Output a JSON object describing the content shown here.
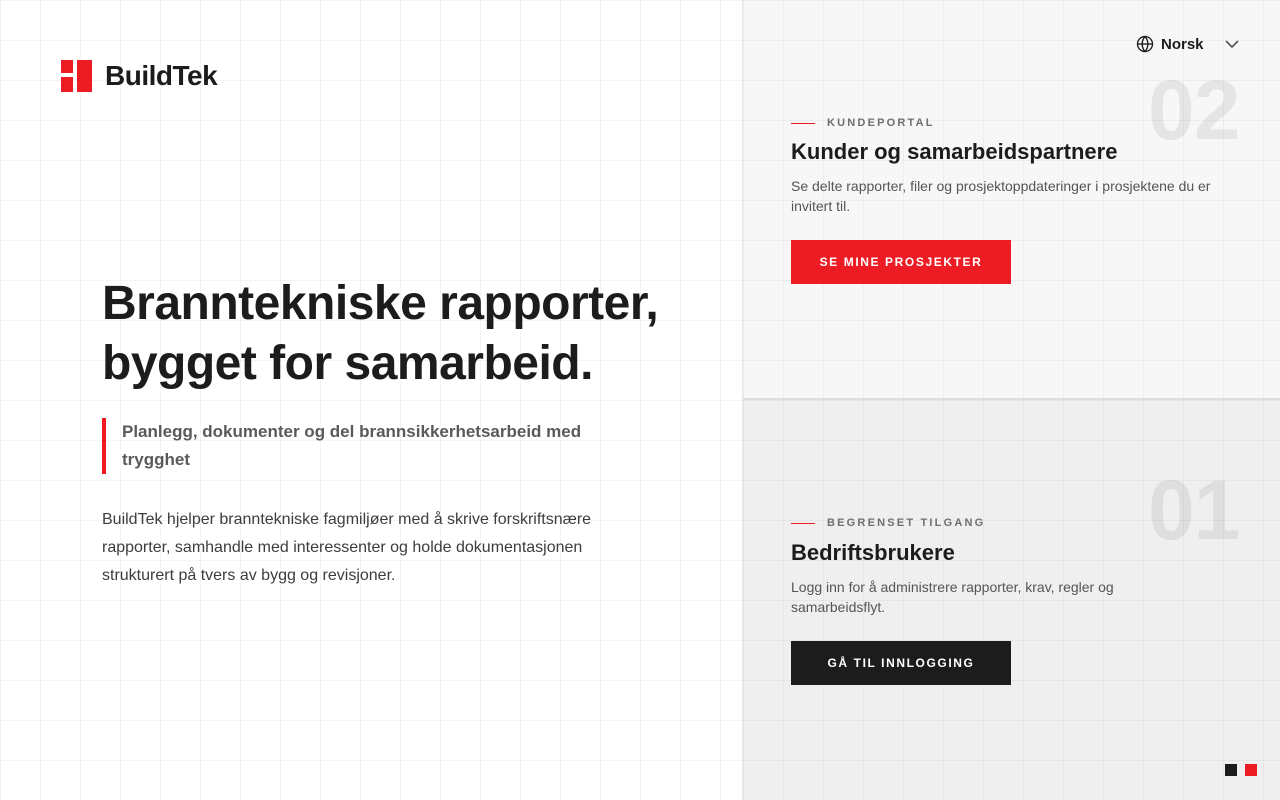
{
  "brand": {
    "name": "BuildTek",
    "accent_color": "#ed1c24",
    "dark_color": "#1c1c1c"
  },
  "hero": {
    "title_line1": "Branntekniske rapporter,",
    "title_line2": "bygget for samarbeid.",
    "quote": "Planlegg, dokumenter og del brannsikkerhetsarbeid med trygghet",
    "body": "BuildTek hjelper branntekniske fagmiljøer med å skrive forskriftsnære rapporter, samhandle med interessenter og holde dokumentasjonen strukturert på tvers av bygg og revisjoner."
  },
  "language": {
    "label": "Norsk",
    "icon": "globe-icon"
  },
  "portals": [
    {
      "number": "02",
      "eyebrow": "KUNDEPORTAL",
      "title": "Kunder og samarbeidspartnere",
      "description": "Se delte rapporter, filer og prosjektoppdateringer i prosjektene du er invitert til.",
      "button": "SE MINE PROSJEKTER"
    },
    {
      "number": "01",
      "eyebrow": "BEGRENSET TILGANG",
      "title": "Bedriftsbrukere",
      "description": "Logg inn for å administrere rapporter, krav, regler og samarbeidsflyt.",
      "button": "GÅ TIL INNLOGGING"
    }
  ]
}
